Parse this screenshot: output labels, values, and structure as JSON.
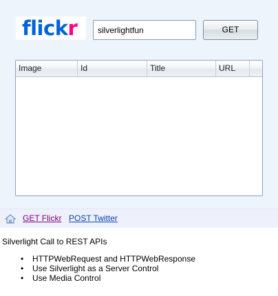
{
  "header": {
    "logo": {
      "part1": "flick",
      "part2": "r",
      "tm": "™"
    },
    "search": {
      "value": "silverlightfun",
      "placeholder": ""
    },
    "get_label": "GET"
  },
  "grid": {
    "columns": [
      "Image",
      "Id",
      "Title",
      "URL"
    ],
    "rows": []
  },
  "nav": {
    "links": [
      "GET Flickr",
      "POST Twitter"
    ]
  },
  "content": {
    "intro": "Silverlight Call to REST APIs",
    "features": [
      "HTTPWebRequest and HTTPWebResponse",
      "Use Silverlight as a Server Control",
      "Use Media Control"
    ]
  },
  "colors": {
    "brand_blue": "#0063dc",
    "brand_pink": "#ff0084",
    "panel_background": "#eef4fb",
    "visited_link": "#800080",
    "link": "#0645ad"
  },
  "icons": {
    "home": "home-icon"
  }
}
